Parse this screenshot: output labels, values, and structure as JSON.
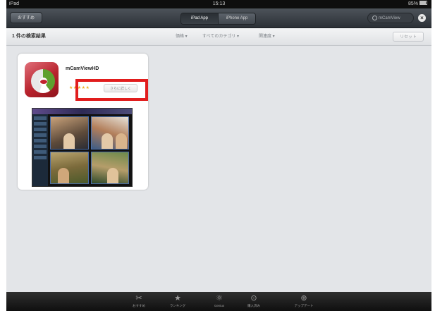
{
  "status": {
    "carrier": "iPad",
    "time": "15:13",
    "battery": "85%"
  },
  "nav": {
    "back_label": "おすすめ",
    "segments": [
      "iPad App",
      "iPhone App"
    ],
    "search_value": "mCamView"
  },
  "filters": {
    "result_count": "1 件の検索結果",
    "price": "価格 ▾",
    "category": "すべてのカテゴリ ▾",
    "relevance": "関連度 ▾",
    "reset": "リセット"
  },
  "result": {
    "app_name": "mCamViewHD",
    "rating": "★★★★★",
    "detail_button": "さらに詳しく"
  },
  "tabs": [
    {
      "icon": "featured-icon",
      "label": "おすすめ"
    },
    {
      "icon": "star-icon",
      "label": "ランキング"
    },
    {
      "icon": "genius-icon",
      "label": "Genius"
    },
    {
      "icon": "purchased-icon",
      "label": "購入済み"
    },
    {
      "icon": "updates-icon",
      "label": "アップデート"
    }
  ],
  "colors": {
    "highlight": "#e11d1d",
    "nav": "#2b3036",
    "tabbar": "#0f0f0f"
  }
}
